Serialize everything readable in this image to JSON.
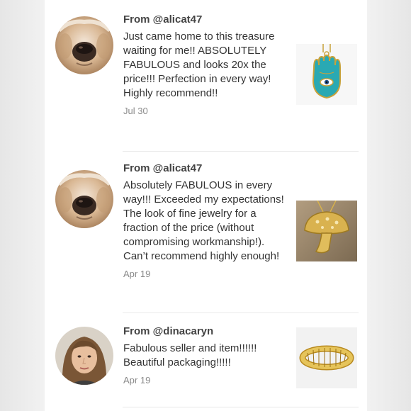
{
  "reviews": [
    {
      "from": "From @alicat47",
      "text": "Just came home to this treasure waiting for me!! ABSOLUTELY FABULOUS and looks 20x the price!!! Perfection in every way! Highly recommend!!",
      "date": "Jul 30",
      "avatar_icon": "dog-avatar-icon",
      "product_icon": "hamsa-pendant-icon"
    },
    {
      "from": "From @alicat47",
      "text": "Absolutely FABULOUS in every way!!! Exceeded my expectations! The look of fine jewelry for a fraction of the price (without compromising workmanship!). Can’t recommend highly enough!",
      "date": "Apr 19",
      "avatar_icon": "dog-avatar-icon",
      "product_icon": "mushroom-pendant-icon"
    },
    {
      "from": "From @dinacaryn",
      "text": "Fabulous seller and item!!!!!! Beautiful packaging!!!!!",
      "date": "Apr 19",
      "avatar_icon": "woman-avatar-icon",
      "product_icon": "gold-bracelet-icon"
    }
  ],
  "colors": {
    "panel": "#ffffff",
    "background": "#ececec",
    "username": "#444444",
    "text": "#333333",
    "date": "#8a8a8a",
    "divider": "#e9e9e9",
    "turquoise": "#2aa9b3",
    "gold": "#c9a23a"
  }
}
